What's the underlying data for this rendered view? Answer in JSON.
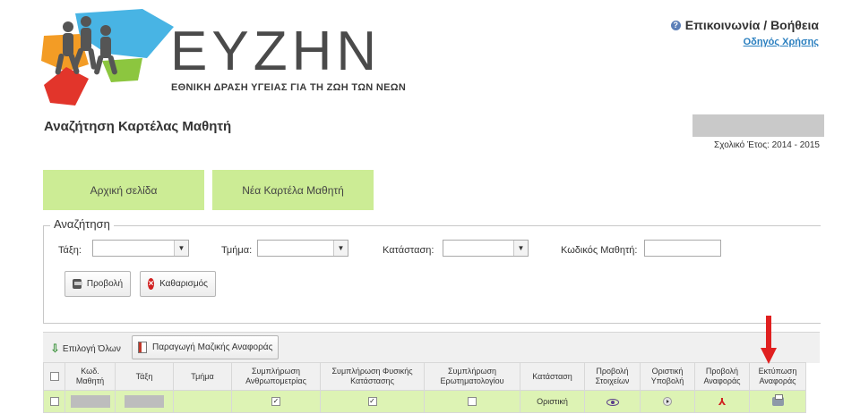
{
  "logo": {
    "title": "ΕΥΖΗΝ",
    "subtitle": "ΕΘΝΙΚΗ ΔΡΑΣΗ ΥΓΕΙΑΣ ΓΙΑ ΤΗ ΖΩΗ ΤΩΝ ΝΕΩΝ",
    "colors": {
      "blue": "#48b4e4",
      "orange": "#f39c25",
      "red": "#e2352b",
      "green": "#8cc63f",
      "figures": "#555555"
    }
  },
  "header": {
    "help_link": "Επικοινωνία / Βοήθεια",
    "guide_link": "Οδηγός Χρήσης"
  },
  "page": {
    "title": "Αναζήτηση Καρτέλας Μαθητή",
    "school_year": "Σχολικό Έτος: 2014 - 2015"
  },
  "nav_buttons": {
    "home": "Αρχική σελίδα",
    "new_card": "Νέα Καρτέλα Μαθητή"
  },
  "search": {
    "legend": "Αναζήτηση",
    "class_label": "Τάξη:",
    "section_label": "Τμήμα:",
    "status_label": "Κατάσταση:",
    "student_code_label": "Κωδικός Μαθητή:",
    "class_value": "",
    "section_value": "",
    "status_value": "",
    "student_code_value": "",
    "view_button": "Προβολή",
    "clear_button": "Καθαρισμός"
  },
  "toolbar": {
    "select_all": "Επιλογή Όλων",
    "mass_report": "Παραγωγή Μαζικής Αναφοράς"
  },
  "table": {
    "headers": [
      "",
      "Κωδ. Μαθητή",
      "Τάξη",
      "Τμήμα",
      "Συμπλήρωση Ανθρωπομετρίας",
      "Συμπλήρωση Φυσικής Κατάστασης",
      "Συμπλήρωση Ερωτηματολογίου",
      "Κατάσταση",
      "Προβολή Στοιχείων",
      "Οριστική Υποβολή",
      "Προβολή Αναφοράς",
      "Εκτύπωση Αναφοράς"
    ],
    "rows": [
      {
        "selected": false,
        "anthropometry": true,
        "fitness": true,
        "questionnaire": false,
        "status": "Οριστική",
        "view_icon": "eye-icon",
        "submit_icon": "play-icon",
        "report_icon": "pdf-icon",
        "print_icon": "printer-icon"
      }
    ]
  },
  "colors": {
    "green_button": "#ccec95",
    "row_highlight": "#ddf3b4",
    "annotation_arrow": "#e02020"
  }
}
